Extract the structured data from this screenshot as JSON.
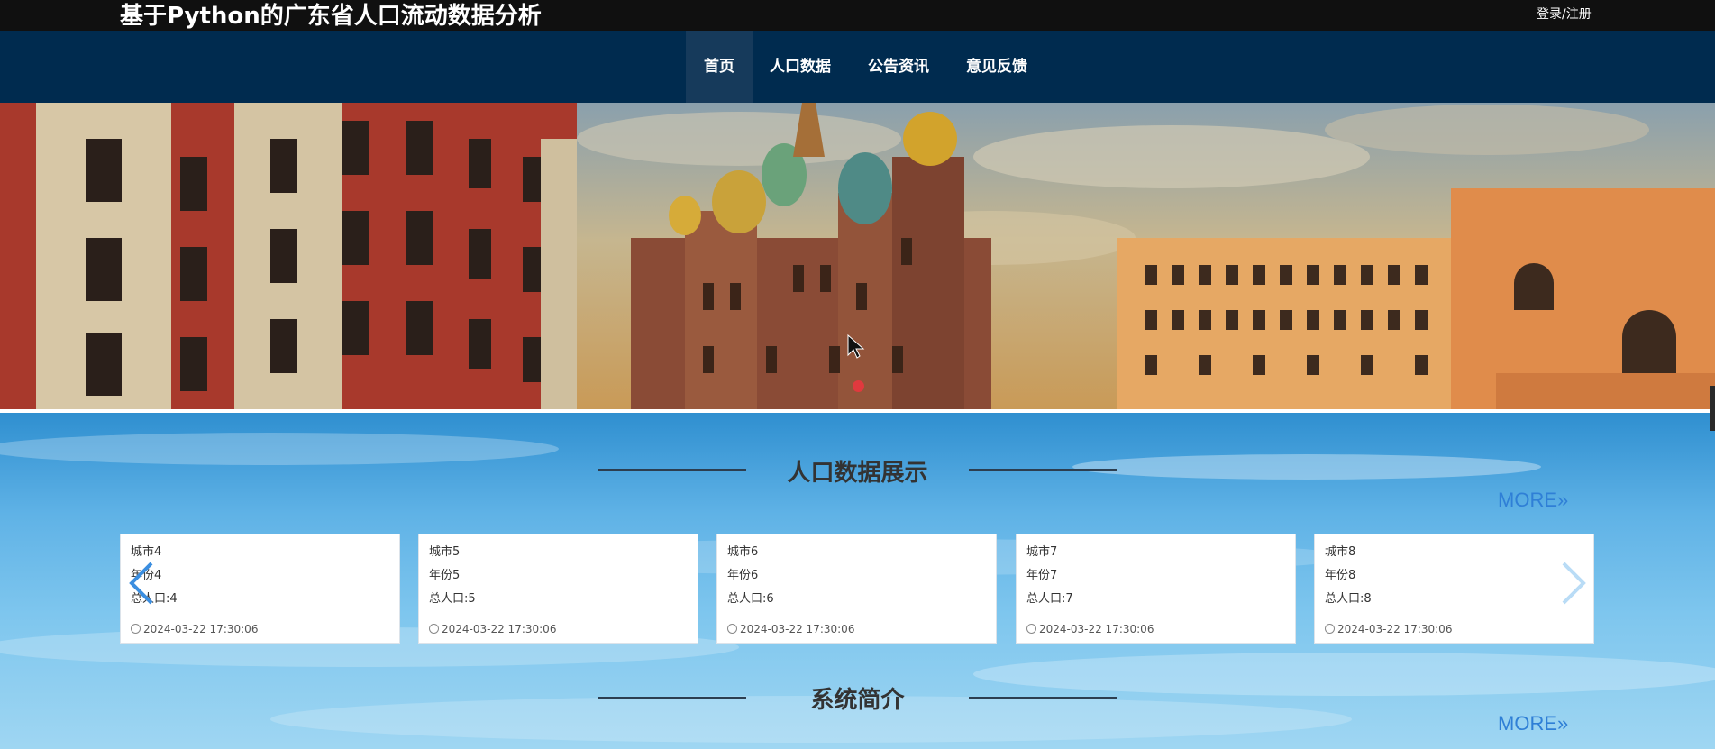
{
  "header": {
    "site_title": "基于Python的广东省人口流动数据分析",
    "login_label": "登录/注册"
  },
  "nav": {
    "items": [
      {
        "label": "首页",
        "active": true
      },
      {
        "label": "人口数据",
        "active": false
      },
      {
        "label": "公告资讯",
        "active": false
      },
      {
        "label": "意见反馈",
        "active": false
      }
    ]
  },
  "banner": {
    "slide_count": 1,
    "active_slide": 1
  },
  "population_section": {
    "title": "人口数据展示",
    "more_label": "MORE»",
    "cards": [
      {
        "city": "城市4",
        "year": "年份4",
        "total": "总人口:4",
        "time": "2024-03-22 17:30:06"
      },
      {
        "city": "城市5",
        "year": "年份5",
        "total": "总人口:5",
        "time": "2024-03-22 17:30:06"
      },
      {
        "city": "城市6",
        "year": "年份6",
        "total": "总人口:6",
        "time": "2024-03-22 17:30:06"
      },
      {
        "city": "城市7",
        "year": "年份7",
        "total": "总人口:7",
        "time": "2024-03-22 17:30:06"
      },
      {
        "city": "城市8",
        "year": "年份8",
        "total": "总人口:8",
        "time": "2024-03-22 17:30:06"
      }
    ]
  },
  "intro_section": {
    "title": "系统简介",
    "more_label": "MORE»"
  },
  "icons": [
    "clock-icon",
    "chevron-left-icon",
    "chevron-right-icon",
    "mouse-cursor-icon"
  ],
  "colors": {
    "topbar": "#101010",
    "navbar": "#002b4f",
    "nav_active": "#163a5b",
    "more_link": "#2f7fd6",
    "banner_dot": "#e0393e"
  }
}
